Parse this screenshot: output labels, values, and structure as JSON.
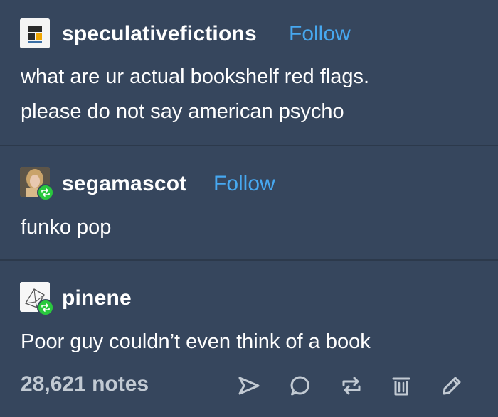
{
  "posts": [
    {
      "username": "speculativefictions",
      "follow_label": "Follow",
      "avatar_icon": "blog-avatar-blocks",
      "lines": [
        "what are ur actual bookshelf red flags.",
        "please do not say american psycho"
      ]
    },
    {
      "username": "segamascot",
      "follow_label": "Follow",
      "avatar_icon": "blog-avatar-photo",
      "reblog_icon": "reblog-badge-icon",
      "lines": [
        "funko pop"
      ]
    },
    {
      "username": "pinene",
      "avatar_icon": "blog-avatar-sketch",
      "reblog_icon": "reblog-badge-icon",
      "lines": [
        "Poor guy couldn’t even think of a book"
      ]
    }
  ],
  "footer": {
    "notes_label": "28,621 notes",
    "actions": [
      {
        "name": "share",
        "icon": "send-icon"
      },
      {
        "name": "reply",
        "icon": "comment-icon"
      },
      {
        "name": "reblog",
        "icon": "reblog-icon"
      },
      {
        "name": "delete",
        "icon": "trash-icon"
      },
      {
        "name": "edit",
        "icon": "pencil-icon"
      }
    ]
  },
  "colors": {
    "background": "#36465d",
    "divider": "#2c394b",
    "follow": "#47a8f0",
    "reblog_badge": "#29c83e",
    "icon": "#c2cad3"
  }
}
